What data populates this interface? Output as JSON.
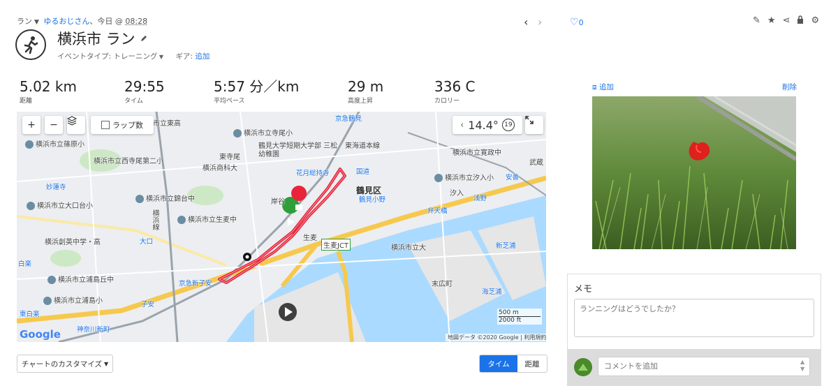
{
  "breadcrumb": {
    "activity": "ラン",
    "user": "ゆるおじさん",
    "sep": "、",
    "day": "今日",
    "at": "@",
    "time": "08:28"
  },
  "activity": {
    "title": "横浜市 ラン",
    "event_type_label": "イベントタイプ:",
    "event_type_value": "トレーニング",
    "gear_label": "ギア:",
    "gear_add": "追加"
  },
  "stats": [
    {
      "value": "5.02 km",
      "label": "距離"
    },
    {
      "value": "29:55",
      "label": "タイム"
    },
    {
      "value": "5:57 分／km",
      "label": "平均ペース"
    },
    {
      "value": "29 m",
      "label": "高度上昇"
    },
    {
      "value": "336 C",
      "label": "カロリー"
    }
  ],
  "map": {
    "lap_checkbox": "ラップ数",
    "temperature": "14.4°",
    "weather_badge": "19",
    "scale_m": "500 m",
    "scale_ft": "2000 ft",
    "attribution": "地図データ ©2020 Google",
    "terms": "利用規約",
    "google": "Google",
    "labels": {
      "ward": "鶴見区",
      "l1": "横浜市立東高",
      "l2": "横浜市立篠原小",
      "l3": "横浜市立寺尾小",
      "l4": "鶴見大学短期大学部 三松幼稚園",
      "l5": "横浜市立西寺尾第二小",
      "l6": "横浜商科大",
      "l7": "東寺尾",
      "l8": "妙蓮寺",
      "l9": "横浜市立大口台小",
      "l10": "横浜市立錦台中",
      "l11": "横浜市立生麦中",
      "l12": "横浜創英中学・高",
      "l13": "大口",
      "l14": "白楽",
      "l15": "横浜市立浦島丘中",
      "l16": "横浜市立浦島小",
      "l17": "東白楽",
      "l18": "神奈川新町",
      "l19": "子安",
      "l20": "京急新子安",
      "l21": "花月総持寺",
      "l22": "国道",
      "l23": "鶴見小野",
      "l24": "横浜市立汐入小",
      "l25": "横浜市立寛政中",
      "l26": "浅野",
      "l27": "弁天橋",
      "l28": "横浜市立大",
      "l29": "新芝浦",
      "l30": "海芝浦",
      "l31": "末広町",
      "l32": "生麦JCT",
      "l33": "岸谷",
      "l34": "生麦",
      "l35": "京急鶴見",
      "l36": "安善",
      "l37": "武蔵",
      "l38": "汐入",
      "l39": "横浜線",
      "l40": "東海道本線"
    }
  },
  "controls": {
    "chart_customize": "チャートのカスタマイズ",
    "seg_time": "タイム",
    "seg_distance": "距離"
  },
  "right": {
    "likes": "0",
    "photo_add": "追加",
    "photo_delete": "削除",
    "memo_title": "メモ",
    "memo_placeholder": "ランニングはどうでしたか？",
    "comment_placeholder": "コメントを追加"
  },
  "colors": {
    "accent": "#1a73e8",
    "route": "#e8233a",
    "start": "#2e9e3a",
    "finish": "#e8233a"
  }
}
